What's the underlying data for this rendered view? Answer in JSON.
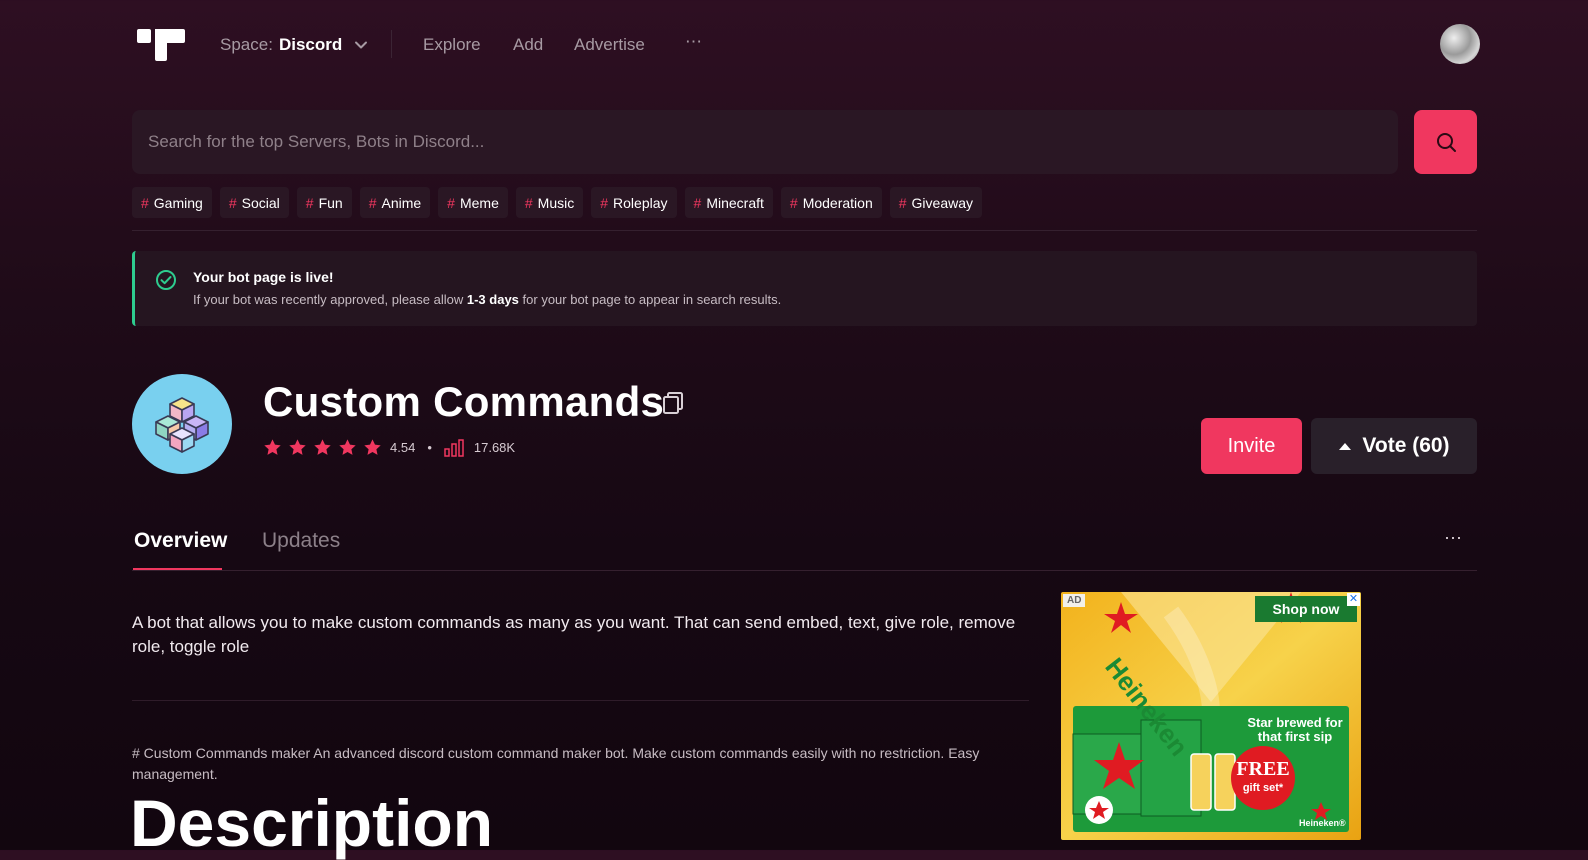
{
  "header": {
    "space_label": "Space:",
    "space_value": "Discord",
    "nav": [
      "Explore",
      "Add",
      "Advertise"
    ],
    "more": "⋯"
  },
  "search": {
    "placeholder": "Search for the top Servers, Bots in Discord..."
  },
  "tags": [
    "Gaming",
    "Social",
    "Fun",
    "Anime",
    "Meme",
    "Music",
    "Roleplay",
    "Minecraft",
    "Moderation",
    "Giveaway"
  ],
  "alert": {
    "title": "Your bot page is live!",
    "text_before": "If your bot was recently approved, please allow ",
    "text_bold": "1-3 days",
    "text_after": " for your bot page to appear in search results."
  },
  "bot": {
    "name": "Custom Commands",
    "rating": "4.54",
    "stars": 5,
    "views": "17.68K",
    "invite_label": "Invite",
    "vote_label": "Vote (60)"
  },
  "tabs": {
    "overview": "Overview",
    "updates": "Updates",
    "more": "⋯"
  },
  "content": {
    "short_description": "A bot that allows you to make custom commands as many as you want. That can send embed, text, give role, remove role, toggle role",
    "long_description": "# Custom Commands maker An advanced discord custom command maker bot. Make custom commands easily with no restriction. Easy management.",
    "heading": "Description"
  },
  "ad": {
    "badge": "AD",
    "shop": "Shop now",
    "brand": "Heineken",
    "tagline": "Star brewed for that first sip",
    "free": "FREE",
    "gift": "gift set*",
    "brand_small": "Heineken®"
  },
  "colors": {
    "accent": "#f0375f",
    "success": "#2ecc8f",
    "panel": "#2a1724"
  }
}
